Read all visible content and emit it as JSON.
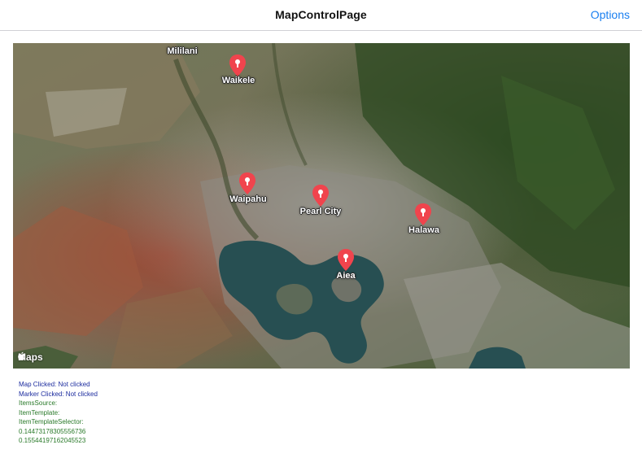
{
  "navbar": {
    "title": "MapControlPage",
    "options_label": "Options",
    "accent_color": "#1a7ff0"
  },
  "map": {
    "attribution": "Maps",
    "attribution_icon": "apple-icon",
    "labels": {
      "mililani": "Mililani",
      "waikele": "Waikele",
      "waipahu": "Waipahu",
      "pearl_city": "Pearl City",
      "halawa": "Halawa",
      "aiea": "Aiea"
    },
    "pin_color": "#f0444d"
  },
  "status": {
    "map_clicked": "Map Clicked: Not clicked",
    "marker_clicked": "Marker Clicked: Not clicked",
    "items_source": "ItemsSource:",
    "item_template": "ItemTemplate:",
    "item_template_selector": "ItemTemplateSelector:",
    "value_1": "0.14473178305556736",
    "value_2": "0.15544197162045523"
  }
}
